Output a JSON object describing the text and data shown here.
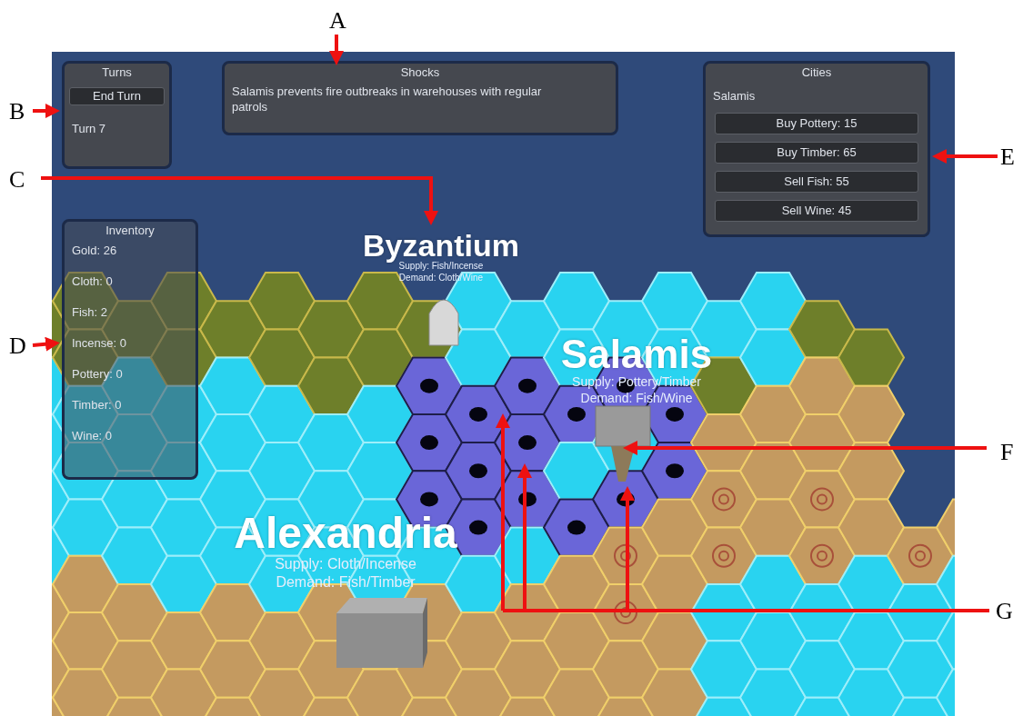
{
  "annotations": [
    {
      "label": "A"
    },
    {
      "label": "B"
    },
    {
      "label": "C"
    },
    {
      "label": "D"
    },
    {
      "label": "E"
    },
    {
      "label": "F"
    },
    {
      "label": "G"
    }
  ],
  "turns_panel": {
    "title": "Turns",
    "button": "End Turn",
    "turn": "Turn 7"
  },
  "shocks_panel": {
    "title": "Shocks",
    "message": "Salamis prevents fire outbreaks in warehouses with regular patrols"
  },
  "cities_panel": {
    "title": "Cities",
    "city": "Salamis",
    "buttons": [
      "Buy Pottery: 15",
      "Buy Timber: 65",
      "Sell Fish: 55",
      "Sell Wine: 45"
    ]
  },
  "inventory_panel": {
    "title": "Inventory",
    "items": [
      "Gold: 26",
      "Cloth: 0",
      "Fish: 2",
      "Incense: 0",
      "Pottery: 0",
      "Timber: 0",
      "Wine: 0"
    ]
  },
  "map": {
    "cities": [
      {
        "name": "Byzantium",
        "supply": "Supply: Fish/Incense",
        "demand": "Demand: Cloth/Wine"
      },
      {
        "name": "Salamis",
        "supply": "Supply: Pottery/Timber",
        "demand": "Demand: Fish/Wine"
      },
      {
        "name": "Alexandria",
        "supply": "Supply: Cloth/Incense",
        "demand": "Demand: Fish/Timber"
      }
    ]
  }
}
